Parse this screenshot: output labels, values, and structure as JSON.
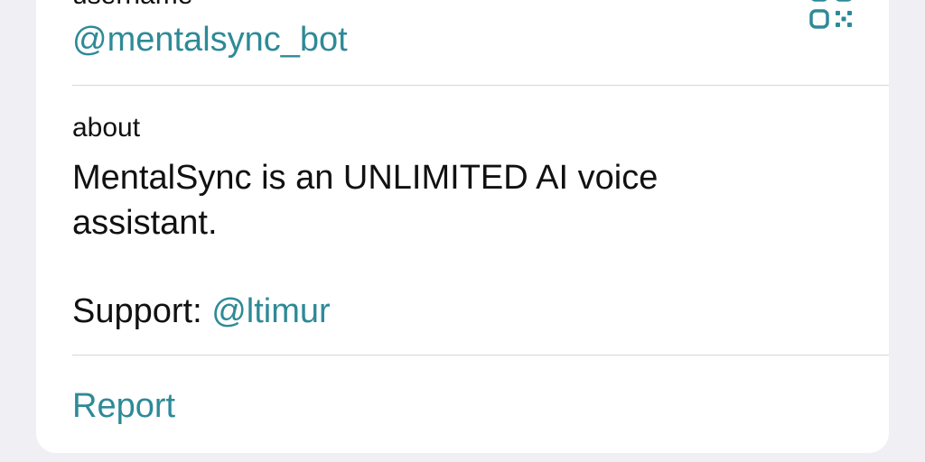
{
  "profile": {
    "username_caption": "username",
    "username_value": "@mentalsync_bot",
    "qr_icon": "qr-code-icon",
    "about_caption": "about",
    "about_text": "MentalSync is an UNLIMITED AI voice\nassistant.",
    "support_label": "Support: ",
    "support_link": "@ltimur",
    "report_label": "Report"
  },
  "colors": {
    "background": "#efeff4",
    "card": "#ffffff",
    "accent": "#2e8a97",
    "text": "#111111",
    "divider": "#d7d7dc"
  }
}
